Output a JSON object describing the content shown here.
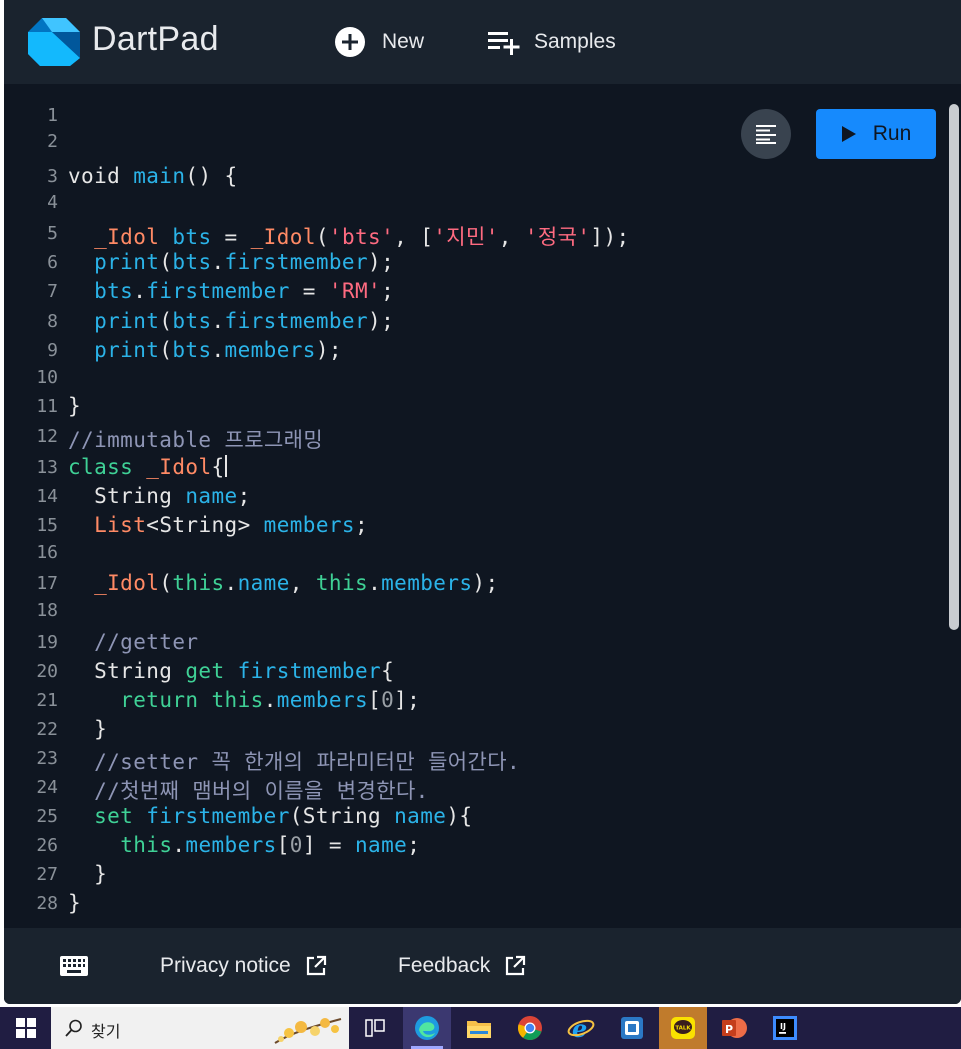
{
  "app": {
    "title": "DartPad"
  },
  "toolbar": {
    "new_label": "New",
    "samples_label": "Samples"
  },
  "editor": {
    "run_label": "Run",
    "lines": [
      {
        "n": "1",
        "tokens": []
      },
      {
        "n": "2",
        "tokens": []
      },
      {
        "n": "3",
        "tokens": [
          {
            "t": "void ",
            "c": ""
          },
          {
            "t": "main",
            "c": "fn"
          },
          {
            "t": "() {",
            "c": ""
          }
        ]
      },
      {
        "n": "4",
        "tokens": []
      },
      {
        "n": "5",
        "tokens": [
          {
            "t": "  ",
            "c": ""
          },
          {
            "t": "_Idol",
            "c": "ty"
          },
          {
            "t": " ",
            "c": ""
          },
          {
            "t": "bts",
            "c": "fn"
          },
          {
            "t": " = ",
            "c": ""
          },
          {
            "t": "_Idol",
            "c": "ty"
          },
          {
            "t": "(",
            "c": ""
          },
          {
            "t": "'bts'",
            "c": "str"
          },
          {
            "t": ", [",
            "c": ""
          },
          {
            "t": "'지민'",
            "c": "str"
          },
          {
            "t": ", ",
            "c": ""
          },
          {
            "t": "'정국'",
            "c": "str"
          },
          {
            "t": "]);",
            "c": ""
          }
        ]
      },
      {
        "n": "6",
        "tokens": [
          {
            "t": "  ",
            "c": ""
          },
          {
            "t": "print",
            "c": "fn"
          },
          {
            "t": "(",
            "c": ""
          },
          {
            "t": "bts",
            "c": "fn"
          },
          {
            "t": ".",
            "c": ""
          },
          {
            "t": "firstmember",
            "c": "fn"
          },
          {
            "t": ");",
            "c": ""
          }
        ]
      },
      {
        "n": "7",
        "tokens": [
          {
            "t": "  ",
            "c": ""
          },
          {
            "t": "bts",
            "c": "fn"
          },
          {
            "t": ".",
            "c": ""
          },
          {
            "t": "firstmember",
            "c": "fn"
          },
          {
            "t": " = ",
            "c": ""
          },
          {
            "t": "'RM'",
            "c": "str"
          },
          {
            "t": ";",
            "c": ""
          }
        ]
      },
      {
        "n": "8",
        "tokens": [
          {
            "t": "  ",
            "c": ""
          },
          {
            "t": "print",
            "c": "fn"
          },
          {
            "t": "(",
            "c": ""
          },
          {
            "t": "bts",
            "c": "fn"
          },
          {
            "t": ".",
            "c": ""
          },
          {
            "t": "firstmember",
            "c": "fn"
          },
          {
            "t": ");",
            "c": ""
          }
        ]
      },
      {
        "n": "9",
        "tokens": [
          {
            "t": "  ",
            "c": ""
          },
          {
            "t": "print",
            "c": "fn"
          },
          {
            "t": "(",
            "c": ""
          },
          {
            "t": "bts",
            "c": "fn"
          },
          {
            "t": ".",
            "c": ""
          },
          {
            "t": "members",
            "c": "fn"
          },
          {
            "t": ");",
            "c": ""
          }
        ]
      },
      {
        "n": "10",
        "tokens": []
      },
      {
        "n": "11",
        "tokens": [
          {
            "t": "}",
            "c": ""
          }
        ]
      },
      {
        "n": "12",
        "tokens": [
          {
            "t": "//immutable 프로그래밍",
            "c": "cm"
          }
        ]
      },
      {
        "n": "13",
        "tokens": [
          {
            "t": "class",
            "c": "kw"
          },
          {
            "t": " ",
            "c": ""
          },
          {
            "t": "_Idol",
            "c": "ty"
          },
          {
            "t": "{",
            "c": ""
          }
        ],
        "cursor": true
      },
      {
        "n": "14",
        "tokens": [
          {
            "t": "  String ",
            "c": ""
          },
          {
            "t": "name",
            "c": "fn"
          },
          {
            "t": ";",
            "c": ""
          }
        ]
      },
      {
        "n": "15",
        "tokens": [
          {
            "t": "  ",
            "c": ""
          },
          {
            "t": "List",
            "c": "ty"
          },
          {
            "t": "<String> ",
            "c": ""
          },
          {
            "t": "members",
            "c": "fn"
          },
          {
            "t": ";",
            "c": ""
          }
        ]
      },
      {
        "n": "16",
        "tokens": []
      },
      {
        "n": "17",
        "tokens": [
          {
            "t": "  ",
            "c": ""
          },
          {
            "t": "_Idol",
            "c": "ty"
          },
          {
            "t": "(",
            "c": ""
          },
          {
            "t": "this",
            "c": "kw"
          },
          {
            "t": ".",
            "c": ""
          },
          {
            "t": "name",
            "c": "fn"
          },
          {
            "t": ", ",
            "c": ""
          },
          {
            "t": "this",
            "c": "kw"
          },
          {
            "t": ".",
            "c": ""
          },
          {
            "t": "members",
            "c": "fn"
          },
          {
            "t": ");",
            "c": ""
          }
        ]
      },
      {
        "n": "18",
        "tokens": []
      },
      {
        "n": "19",
        "tokens": [
          {
            "t": "  //getter",
            "c": "cm"
          }
        ]
      },
      {
        "n": "20",
        "tokens": [
          {
            "t": "  String ",
            "c": ""
          },
          {
            "t": "get",
            "c": "kw"
          },
          {
            "t": " ",
            "c": ""
          },
          {
            "t": "firstmember",
            "c": "fn"
          },
          {
            "t": "{",
            "c": ""
          }
        ]
      },
      {
        "n": "21",
        "tokens": [
          {
            "t": "    ",
            "c": ""
          },
          {
            "t": "return",
            "c": "kw"
          },
          {
            "t": " ",
            "c": ""
          },
          {
            "t": "this",
            "c": "kw"
          },
          {
            "t": ".",
            "c": ""
          },
          {
            "t": "members",
            "c": "fn"
          },
          {
            "t": "[",
            "c": ""
          },
          {
            "t": "0",
            "c": "num"
          },
          {
            "t": "];",
            "c": ""
          }
        ]
      },
      {
        "n": "22",
        "tokens": [
          {
            "t": "  }",
            "c": ""
          }
        ]
      },
      {
        "n": "23",
        "tokens": [
          {
            "t": "  //setter 꼭 한개의 파라미터만 들어간다.",
            "c": "cm"
          }
        ]
      },
      {
        "n": "24",
        "tokens": [
          {
            "t": "  //첫번째 맴버의 이름을 변경한다.",
            "c": "cm"
          }
        ]
      },
      {
        "n": "25",
        "tokens": [
          {
            "t": "  ",
            "c": ""
          },
          {
            "t": "set",
            "c": "kw"
          },
          {
            "t": " ",
            "c": ""
          },
          {
            "t": "firstmember",
            "c": "fn"
          },
          {
            "t": "(String ",
            "c": ""
          },
          {
            "t": "name",
            "c": "fn"
          },
          {
            "t": "){",
            "c": ""
          }
        ]
      },
      {
        "n": "26",
        "tokens": [
          {
            "t": "    ",
            "c": ""
          },
          {
            "t": "this",
            "c": "kw"
          },
          {
            "t": ".",
            "c": ""
          },
          {
            "t": "members",
            "c": "fn"
          },
          {
            "t": "[",
            "c": ""
          },
          {
            "t": "0",
            "c": "num"
          },
          {
            "t": "] = ",
            "c": ""
          },
          {
            "t": "name",
            "c": "fn"
          },
          {
            "t": ";",
            "c": ""
          }
        ]
      },
      {
        "n": "27",
        "tokens": [
          {
            "t": "  }",
            "c": ""
          }
        ]
      },
      {
        "n": "28",
        "tokens": [
          {
            "t": "}",
            "c": ""
          }
        ]
      }
    ]
  },
  "footer": {
    "privacy_label": "Privacy notice",
    "feedback_label": "Feedback"
  },
  "taskbar": {
    "search_text": "찾기",
    "apps": [
      "task-view-icon",
      "edge-icon",
      "file-explorer-icon",
      "chrome-icon",
      "internet-explorer-icon",
      "app-icon",
      "kakaotalk-icon",
      "powerpoint-icon",
      "intellij-icon"
    ],
    "kakaotalk_badge": "TALK"
  },
  "colors": {
    "keyword": "#3fd196",
    "type": "#ff8a65",
    "identifier": "#2bb3e8",
    "string": "#ff6b81",
    "comment": "#8e95b5",
    "run_button": "#168afd",
    "editor_bg": "#0f1621",
    "appbar_bg": "#1a232e",
    "taskbar_bg": "#201d42"
  }
}
